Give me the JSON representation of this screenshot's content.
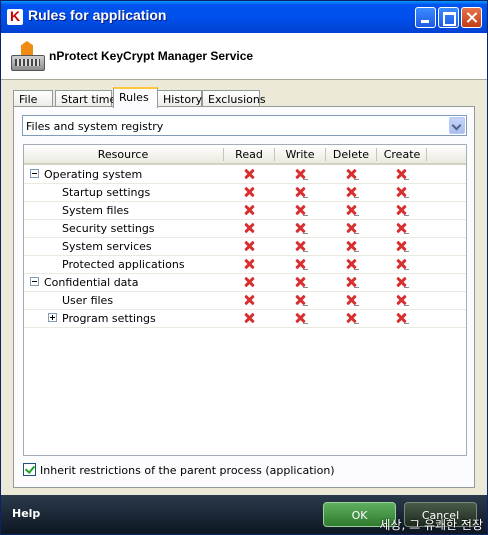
{
  "window": {
    "title": "Rules for application"
  },
  "header": {
    "app_name": "nProtect KeyCrypt Manager Service"
  },
  "tabs": [
    {
      "label": "File"
    },
    {
      "label": "Start time"
    },
    {
      "label": "Rules",
      "active": true
    },
    {
      "label": "History"
    },
    {
      "label": "Exclusions"
    }
  ],
  "resource_filter": {
    "value": "Files and system registry"
  },
  "grid": {
    "columns": [
      "Resource",
      "Read",
      "Write",
      "Delete",
      "Create"
    ],
    "rows": [
      {
        "label": "Operating system",
        "level": 0,
        "expander": "minus",
        "read": "deny",
        "write": "deny",
        "delete": "deny",
        "create": "deny"
      },
      {
        "label": "Startup settings",
        "level": 1,
        "read": "deny",
        "write": "deny",
        "delete": "deny",
        "create": "deny"
      },
      {
        "label": "System files",
        "level": 1,
        "read": "deny",
        "write": "deny",
        "delete": "deny",
        "create": "deny"
      },
      {
        "label": "Security settings",
        "level": 1,
        "read": "deny",
        "write": "deny",
        "delete": "deny",
        "create": "deny"
      },
      {
        "label": "System services",
        "level": 1,
        "read": "deny",
        "write": "deny",
        "delete": "deny",
        "create": "deny"
      },
      {
        "label": "Protected applications",
        "level": 1,
        "read": "deny",
        "write": "deny",
        "delete": "deny",
        "create": "deny"
      },
      {
        "label": "Confidential data",
        "level": 0,
        "expander": "minus",
        "read": "deny",
        "write": "deny",
        "delete": "deny",
        "create": "deny"
      },
      {
        "label": "User files",
        "level": 1,
        "read": "deny",
        "write": "deny",
        "delete": "deny",
        "create": "deny"
      },
      {
        "label": "Program settings",
        "level": 1,
        "expander": "plus",
        "read": "deny",
        "write": "deny",
        "delete": "deny",
        "create": "deny"
      }
    ]
  },
  "inherit_checkbox": {
    "label": "Inherit restrictions of the parent process (application)",
    "checked": true
  },
  "footer": {
    "help": "Help",
    "ok": "OK",
    "cancel": "Cancel"
  },
  "watermark": "세상, 그 유쾌한 전장",
  "colors": {
    "title_bar": "#0053ee",
    "deny_icon": "#d83030",
    "footer": "#1a2634",
    "ok_button": "#3f8f3f"
  }
}
